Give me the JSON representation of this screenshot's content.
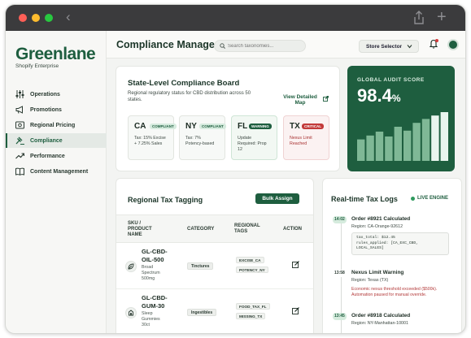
{
  "brand": {
    "name": "Greenlane",
    "subtitle": "Shopify Enterprise"
  },
  "sidebar": {
    "items": [
      {
        "label": "Operations",
        "icon": "sliders-icon"
      },
      {
        "label": "Promotions",
        "icon": "megaphone-icon"
      },
      {
        "label": "Regional Pricing",
        "icon": "price-tag-icon"
      },
      {
        "label": "Compliance",
        "icon": "gavel-icon",
        "active": true
      },
      {
        "label": "Performance",
        "icon": "trend-icon"
      },
      {
        "label": "Content Management",
        "icon": "book-icon"
      }
    ]
  },
  "header": {
    "title": "Compliance Manager",
    "search_placeholder": "Search taxonomies...",
    "store_selector": "Store Selector"
  },
  "board": {
    "title": "State-Level Compliance Board",
    "description": "Regional regulatory status for CBD distribution across 50 states.",
    "view_map": "View Detailed Map",
    "states": [
      {
        "code": "CA",
        "badge": "COMPLIANT",
        "status": "compliant",
        "line1": "Tax: 15% Excise",
        "line2": "+ 7.25% Sales"
      },
      {
        "code": "NY",
        "badge": "COMPLIANT",
        "status": "compliant",
        "line1": "Tax: 7%",
        "line2": "Potency-based"
      },
      {
        "code": "FL",
        "badge": "WARNING",
        "status": "warning",
        "line1": "Update",
        "line2": "Required: Prop",
        "line3": "12"
      },
      {
        "code": "TX",
        "badge": "CRITICAL",
        "status": "critical",
        "line1": "Nexus Limit",
        "line2": "Reached"
      }
    ]
  },
  "audit": {
    "label": "GLOBAL AUDIT SCORE",
    "score": "98.4",
    "unit": "%",
    "bar_levels": [
      0.44,
      0.52,
      0.6,
      0.5,
      0.7,
      0.62,
      0.78,
      0.86,
      0.93,
      1.0
    ],
    "colors": {
      "bar_dim": "#7fb896",
      "bar_bright": "#e9f5ee"
    }
  },
  "tagging": {
    "title": "Regional Tax Tagging",
    "bulk_assign": "Bulk Assign",
    "columns": {
      "sku_line1": "SKU /",
      "sku_line2": "PRODUCT",
      "sku_line3": "NAME",
      "category": "CATEGORY",
      "tags_line1": "REGIONAL",
      "tags_line2": "TAGS",
      "action": "ACTION"
    },
    "rows": [
      {
        "sku1": "GL-CBD-",
        "sku2": "OIL-500",
        "name1": "Broad",
        "name2": "Spectrum",
        "name3": "500mg",
        "category": "Tinctures",
        "tag1": "EXCISE_CA",
        "tag2": "POTENCY_NY",
        "icon": "leaf-icon"
      },
      {
        "sku1": "GL-CBD-",
        "sku2": "GUM-30",
        "name1": "Sleep",
        "name2": "Gummies",
        "name3": "30ct",
        "category": "Ingestibles",
        "tag1": "FOOD_TAX_FL",
        "tag2": "MISSING_TX",
        "icon": "jar-icon"
      }
    ]
  },
  "logs": {
    "title": "Real-time Tax Logs",
    "live": "LIVE ENGINE",
    "entries": [
      {
        "time": "14:02",
        "title": "Order #8921 Calculated",
        "region": "Region: CA-Orange-92612",
        "code1": "tax_total: $12.45",
        "code2": "rules_applied: [CA_EXC_CBD,",
        "code3": "LOCAL_SALES]"
      },
      {
        "time": "13:58",
        "title": "Nexus Limit Warning",
        "region": "Region: Texas (TX)",
        "warn1": "Economic nexus threshold exceeded ($500k).",
        "warn2": "Automation paused for manual override."
      },
      {
        "time": "13:45",
        "title": "Order #8918 Calculated",
        "region": "Region: NY-Manhattan-10001"
      }
    ]
  }
}
